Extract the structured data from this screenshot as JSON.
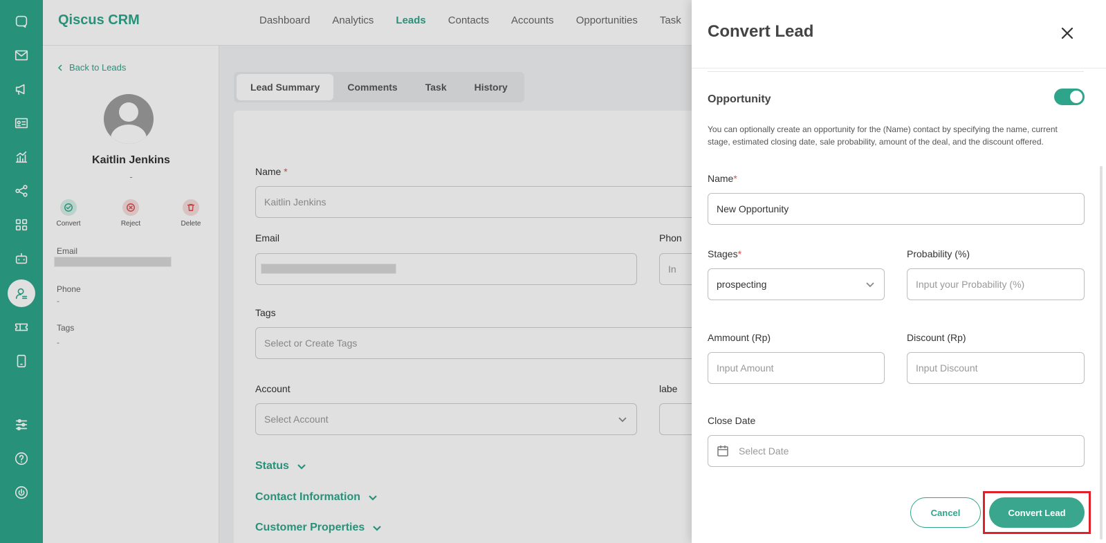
{
  "app": {
    "brand": "Qiscus CRM"
  },
  "nav": [
    "Dashboard",
    "Analytics",
    "Leads",
    "Contacts",
    "Accounts",
    "Opportunities",
    "Task"
  ],
  "nav_active": "Leads",
  "rail_icons": [
    "chat-icon",
    "mail-icon",
    "megaphone-icon",
    "contact-card-icon",
    "analytics-icon",
    "share-icon",
    "apps-icon",
    "bot-icon",
    "crm-user-icon",
    "ticket-icon",
    "mobile-icon",
    "settings-sliders-icon",
    "help-icon",
    "power-icon"
  ],
  "profile": {
    "back": "Back to Leads",
    "name": "Kaitlin Jenkins",
    "subtitle": "-",
    "actions": {
      "convert": "Convert",
      "reject": "Reject",
      "delete": "Delete"
    },
    "email_label": "Email",
    "phone_label": "Phone",
    "phone_value": "-",
    "tags_label": "Tags",
    "tags_value": "-"
  },
  "tabs": [
    "Lead Summary",
    "Comments",
    "Task",
    "History"
  ],
  "form": {
    "name_label": "Name",
    "name_req": "*",
    "name_value": "Kaitlin Jenkins",
    "email_label": "Email",
    "phone_label": "Phon",
    "phone_placeholder": "In",
    "tags_label": "Tags",
    "tags_placeholder": "Select or Create Tags",
    "account_label": "Account",
    "account_placeholder": "Select Account",
    "label_label": "labe",
    "sections": [
      "Status",
      "Contact Information",
      "Customer Properties"
    ]
  },
  "drawer": {
    "title": "Convert Lead",
    "opportunity_title": "Opportunity",
    "opportunity_enabled": true,
    "description": "You can optionally create an opportunity for the (Name) contact by specifying the name, current stage, estimated closing date, sale probability, amount of the deal, and the discount offered.",
    "name_label": "Name",
    "name_req": "*",
    "name_value": "New Opportunity",
    "stages_label": "Stages",
    "stages_req": "*",
    "stages_value": "prospecting",
    "probability_label": "Probability (%)",
    "probability_placeholder": "Input your Probability (%)",
    "amount_label": "Ammount (Rp)",
    "amount_placeholder": "Input Amount",
    "discount_label": "Discount (Rp)",
    "discount_placeholder": "Input Discount",
    "close_date_label": "Close Date",
    "close_date_placeholder": "Select Date",
    "cancel": "Cancel",
    "convert": "Convert Lead"
  },
  "colors": {
    "brand": "#2ea58a",
    "required": "#e24b4b",
    "highlight": "#e0202a"
  }
}
